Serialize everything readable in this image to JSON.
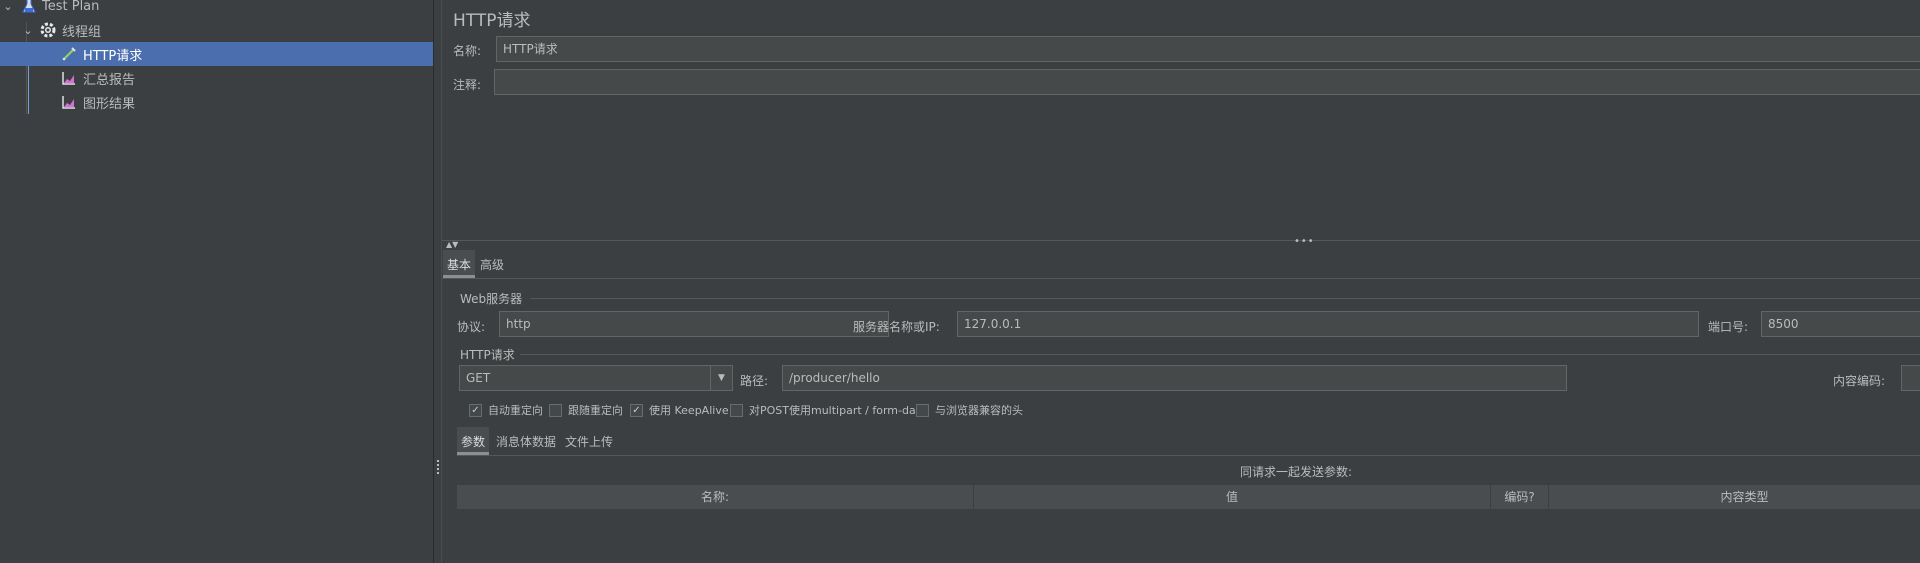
{
  "tree": {
    "items": [
      {
        "label": "Test Plan",
        "icon": "flask-icon"
      },
      {
        "label": "线程组",
        "icon": "gear-icon"
      },
      {
        "label": "HTTP请求",
        "icon": "pipette-icon"
      },
      {
        "label": "汇总报告",
        "icon": "chart-icon"
      },
      {
        "label": "图形结果",
        "icon": "chart-icon"
      }
    ]
  },
  "main": {
    "title": "HTTP请求",
    "name_label": "名称:",
    "name_value": "HTTP请求",
    "comment_label": "注释:",
    "comment_value": "",
    "tabs": [
      {
        "label": "基本"
      },
      {
        "label": "高级"
      }
    ],
    "web_server": {
      "title": "Web服务器",
      "protocol_label": "协议:",
      "protocol_value": "http",
      "server_label": "服务器名称或IP:",
      "server_value": "127.0.0.1",
      "port_label": "端口号:",
      "port_value": "8500"
    },
    "http_request": {
      "title": "HTTP请求",
      "method": "GET",
      "path_label": "路径:",
      "path_value": "/producer/hello",
      "encoding_label": "内容编码:"
    },
    "checkboxes": [
      {
        "label": "自动重定向",
        "checked": true
      },
      {
        "label": "跟随重定向",
        "checked": false
      },
      {
        "label": "使用 KeepAlive",
        "checked": true
      },
      {
        "label": "对POST使用multipart / form-data",
        "checked": false
      },
      {
        "label": "与浏览器兼容的头",
        "checked": false
      }
    ],
    "sub_tabs": [
      {
        "label": "参数"
      },
      {
        "label": "消息体数据"
      },
      {
        "label": "文件上传"
      }
    ],
    "params_caption": "同请求一起发送参数:",
    "table_headers": [
      "名称:",
      "值",
      "编码?",
      "内容类型"
    ]
  },
  "colors": {
    "background": "#3c3f41",
    "selection": "#4b6eaf",
    "field_bg": "#45494a",
    "text": "#bbbbbb"
  }
}
